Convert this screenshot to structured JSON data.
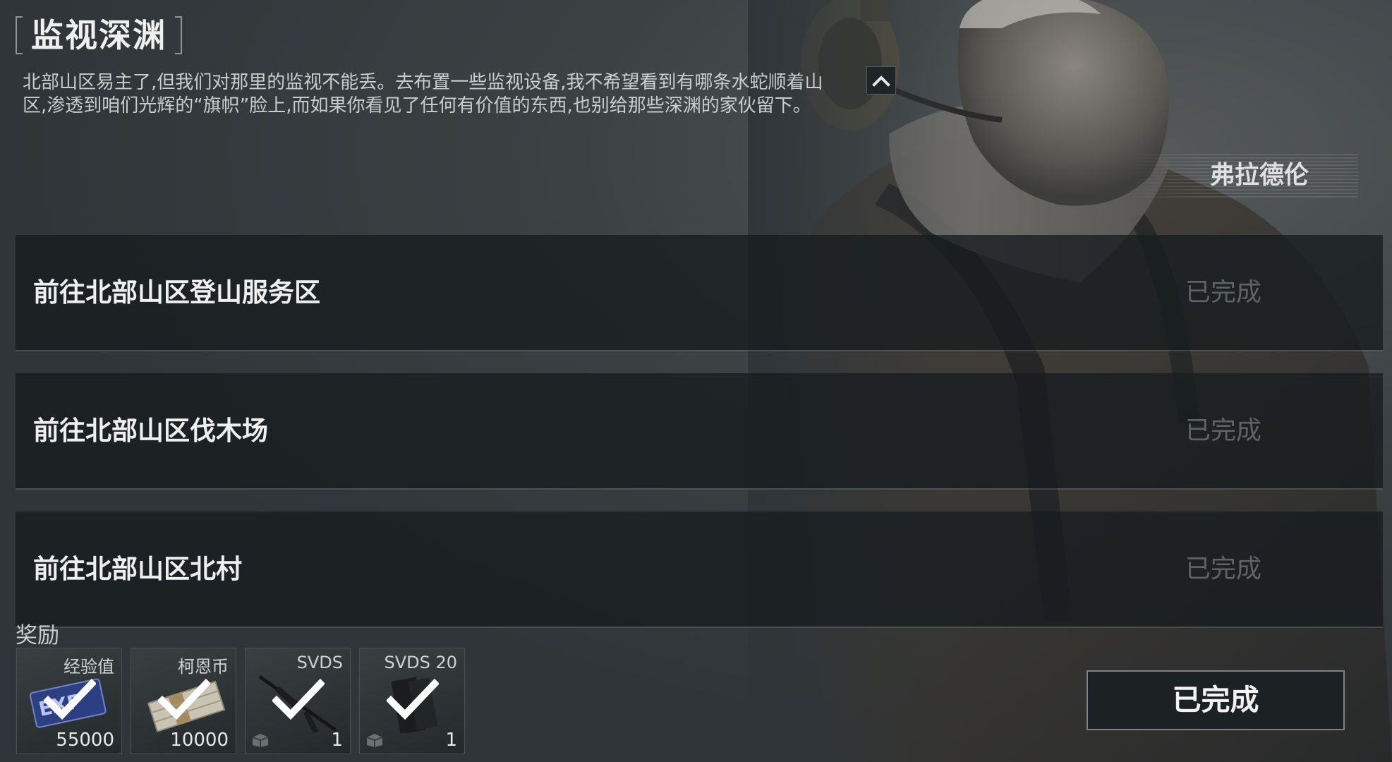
{
  "quest": {
    "title": "监视深渊",
    "description": "北部山区易主了,但我们对那里的监视不能丢。去布置一些监视设备,我不希望看到有哪条水蛇顺着山区,渗透到咱们光辉的“旗帜”脸上,而如果你看见了任何有价值的东西,也别给那些深渊的家伙留下。",
    "npc_name": "弗拉德伦"
  },
  "objectives": [
    {
      "label": "前往北部山区登山服务区",
      "status": "已完成"
    },
    {
      "label": "前往北部山区伐木场",
      "status": "已完成"
    },
    {
      "label": "前往北部山区北村",
      "status": "已完成"
    }
  ],
  "rewards": {
    "label": "奖励",
    "items": [
      {
        "name": "经验值",
        "quantity": "55000",
        "icon": "exp-icon",
        "claimed": true
      },
      {
        "name": "柯恩币",
        "quantity": "10000",
        "icon": "cash-icon",
        "claimed": true
      },
      {
        "name": "SVDS",
        "quantity": "1",
        "icon": "rifle-icon",
        "claimed": true
      },
      {
        "name": "SVDS 20",
        "quantity": "1",
        "icon": "magazine-icon",
        "claimed": true
      }
    ]
  },
  "complete_button": {
    "label": "已完成"
  },
  "colors": {
    "background": "#2f3538",
    "row_background": "#171c1f",
    "status_text": "#5e6466",
    "primary_text": "#eef0ef"
  }
}
